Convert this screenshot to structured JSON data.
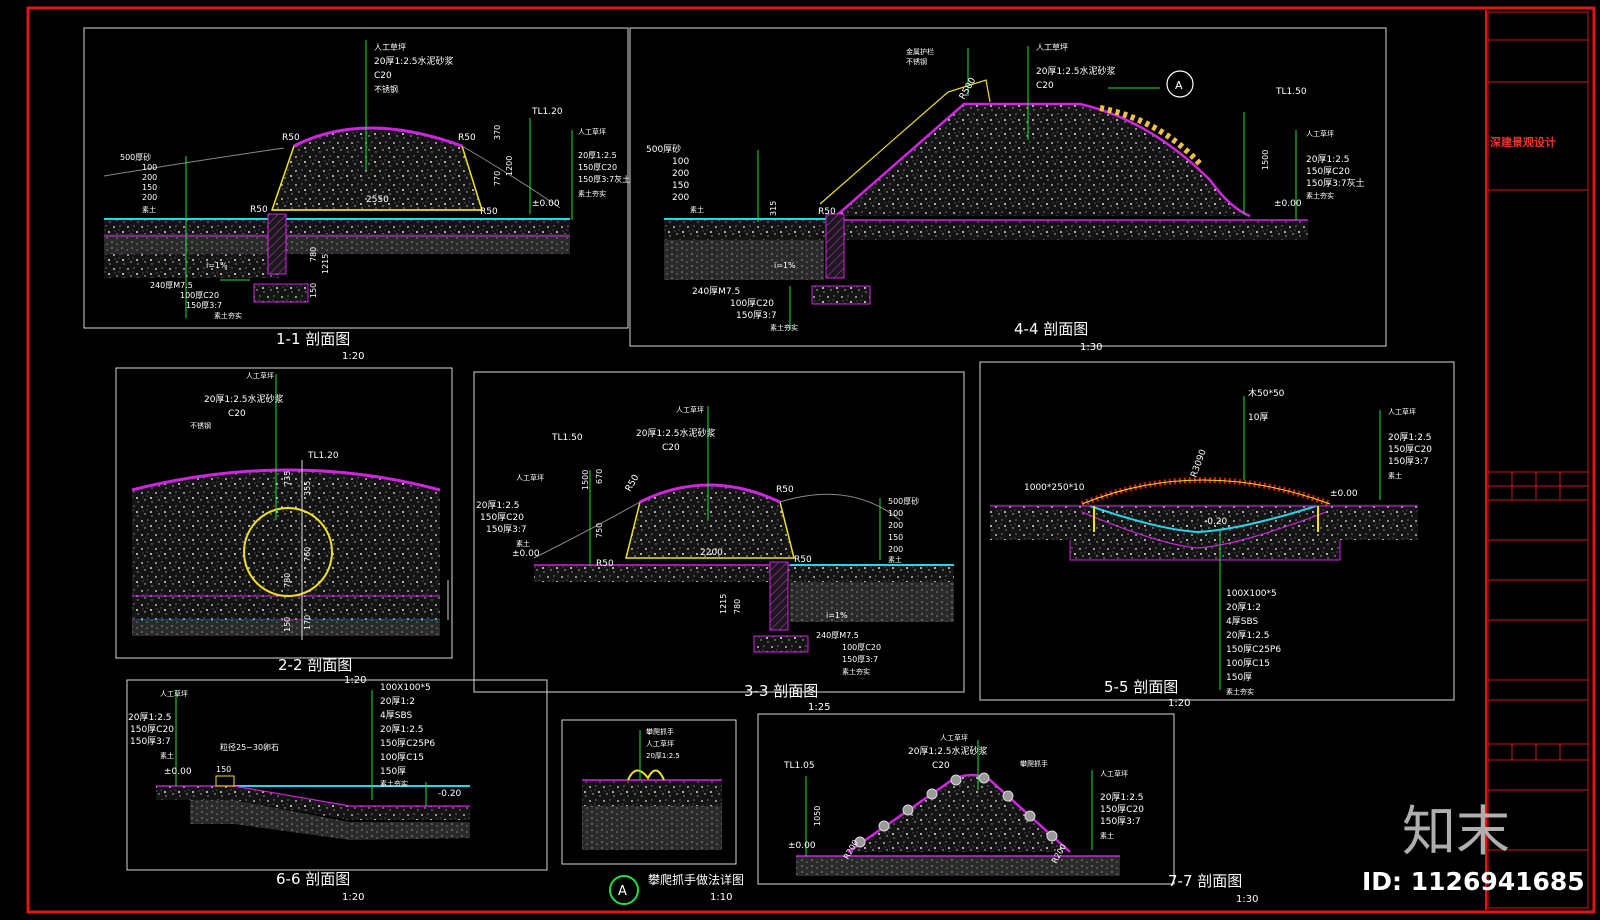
{
  "colors": {
    "frame_red": "#e01616",
    "concrete": "#cfcfcf",
    "accent_magenta": "#d025e0",
    "accent_yellow": "#f0e020",
    "accent_cyan": "#22d8e8",
    "leader_green": "#20e040",
    "dim_green": "#22cc44"
  },
  "sections": {
    "s11": {
      "title": "1-1 剖面图",
      "scale": "1:20",
      "left_layers": [
        "500厚砂",
        "100",
        "200",
        "150",
        "200",
        "素土"
      ],
      "top_layers": [
        "人工草坪",
        "20厚1:2.5水泥砂浆",
        "C20",
        "不锈钢"
      ],
      "right_layers": [
        "人工草坪",
        "20厚1:2.5",
        "150厚C20",
        "150厚3:7灰土",
        "素土夯实"
      ],
      "base_layers": [
        "240厚M7.5",
        "100厚C20",
        "150厚3:7",
        "素土夯实"
      ],
      "dims": {
        "top": "TL1.20",
        "w": "2550",
        "r1": "R50",
        "r2": "R50",
        "r3": "R50",
        "r4": "R50",
        "zero": "±0.00",
        "d1": "370",
        "d2": "770",
        "d3": "1200",
        "d4": "780",
        "d5": "1215",
        "d6": "150",
        "slope": "i=1%"
      }
    },
    "s44": {
      "title": "4-4 剖面图",
      "scale": "1:30",
      "left_layers": [
        "500厚砂",
        "100",
        "200",
        "150",
        "200",
        "素土"
      ],
      "top_layers": [
        "人工草坪",
        "20厚1:2.5水泥砂浆",
        "C20"
      ],
      "mid_layers": [
        "金属护栏",
        "不锈钢"
      ],
      "right_layers": [
        "人工草坪",
        "20厚1:2.5",
        "150厚C20",
        "150厚3:7灰土",
        "素土夯实"
      ],
      "base_layers": [
        "240厚M7.5",
        "100厚C20",
        "150厚3:7",
        "素土夯实"
      ],
      "dims": {
        "top": "TL1.50",
        "r": "R500",
        "r2": "R50",
        "zero": "±0.00",
        "d1": "315",
        "d2": "1500",
        "slope": "i=1%",
        "marker": "A"
      }
    },
    "s22": {
      "title": "2-2 剖面图",
      "scale": "1:20",
      "layers": [
        "人工草坪",
        "20厚1:2.5水泥砂浆",
        "C20",
        "不锈钢"
      ],
      "dims": {
        "top": "TL1.20",
        "a": "735",
        "b": "355",
        "c": "760",
        "d": "780",
        "e": "150",
        "f": "170"
      }
    },
    "s33": {
      "title": "3-3 剖面图",
      "scale": "1:25",
      "left_layers": [
        "人工草坪",
        "20厚1:2.5",
        "150厚C20",
        "150厚3:7",
        "素土"
      ],
      "top_layers": [
        "人工草坪",
        "20厚1:2.5水泥砂浆",
        "C20"
      ],
      "right_layers": [
        "500厚砂",
        "100",
        "200",
        "150",
        "200",
        "素土"
      ],
      "base_layers": [
        "240厚M7.5",
        "100厚C20",
        "150厚3:7",
        "素土夯实"
      ],
      "dims": {
        "top": "TL1.50",
        "w": "2200",
        "r1": "R50",
        "r2": "R50",
        "r3": "R50",
        "r4": "R50",
        "zero": "±0.00",
        "d1": "1500",
        "d2": "670",
        "d3": "750",
        "d4": "1215",
        "d5": "780",
        "slope": "i=1%"
      }
    },
    "s55": {
      "title": "5-5 剖面图",
      "scale": "1:20",
      "top_layers": [
        "木50*50",
        "10厚"
      ],
      "left_label": "1000*250*10",
      "right_layers": [
        "人工草坪",
        "20厚1:2.5",
        "150厚C20",
        "150厚3:7",
        "素土"
      ],
      "bottom_layers": [
        "100X100*5",
        "20厚1:2",
        "4厚SBS",
        "20厚1:2.5",
        "150厚C25P6",
        "100厚C15",
        "150厚",
        "素土夯实"
      ],
      "dims": {
        "r": "R3090",
        "zero": "±0.00",
        "low": "-0.20"
      }
    },
    "s66": {
      "title": "6-6 剖面图",
      "scale": "1:20",
      "left_layers": [
        "人工草坪",
        "20厚1:2.5",
        "150厚C20",
        "150厚3:7",
        "素土"
      ],
      "right_layers": [
        "100X100*5",
        "20厚1:2",
        "4厚SBS",
        "20厚1:2.5",
        "150厚C25P6",
        "100厚C15",
        "150厚",
        "素土夯实"
      ],
      "note": "粒径25~30卵石",
      "dims": {
        "zero": "±0.00",
        "low": "-0.20",
        "w": "150"
      }
    },
    "sA": {
      "title": "攀爬抓手做法详图",
      "scale": "1:10",
      "marker": "A",
      "layers": [
        "攀爬抓手",
        "人工草坪",
        "20厚1:2.5"
      ]
    },
    "s77": {
      "title": "7-7 剖面图",
      "scale": "1:30",
      "left_layers": [
        "人工草坪",
        "20厚1:2.5水泥砂浆",
        "C20"
      ],
      "mid_label": "攀爬抓手",
      "right_layers": [
        "人工草坪",
        "20厚1:2.5",
        "150厚C20",
        "150厚3:7",
        "素土"
      ],
      "dims": {
        "top": "TL1.05",
        "zero": "±0.00",
        "d1": "1050",
        "r1": "R200",
        "r2": "R200"
      }
    }
  },
  "titleblock": {
    "firm": "深建景观设计"
  },
  "watermark": {
    "brand": "知末",
    "id": "ID: 1126941685"
  }
}
